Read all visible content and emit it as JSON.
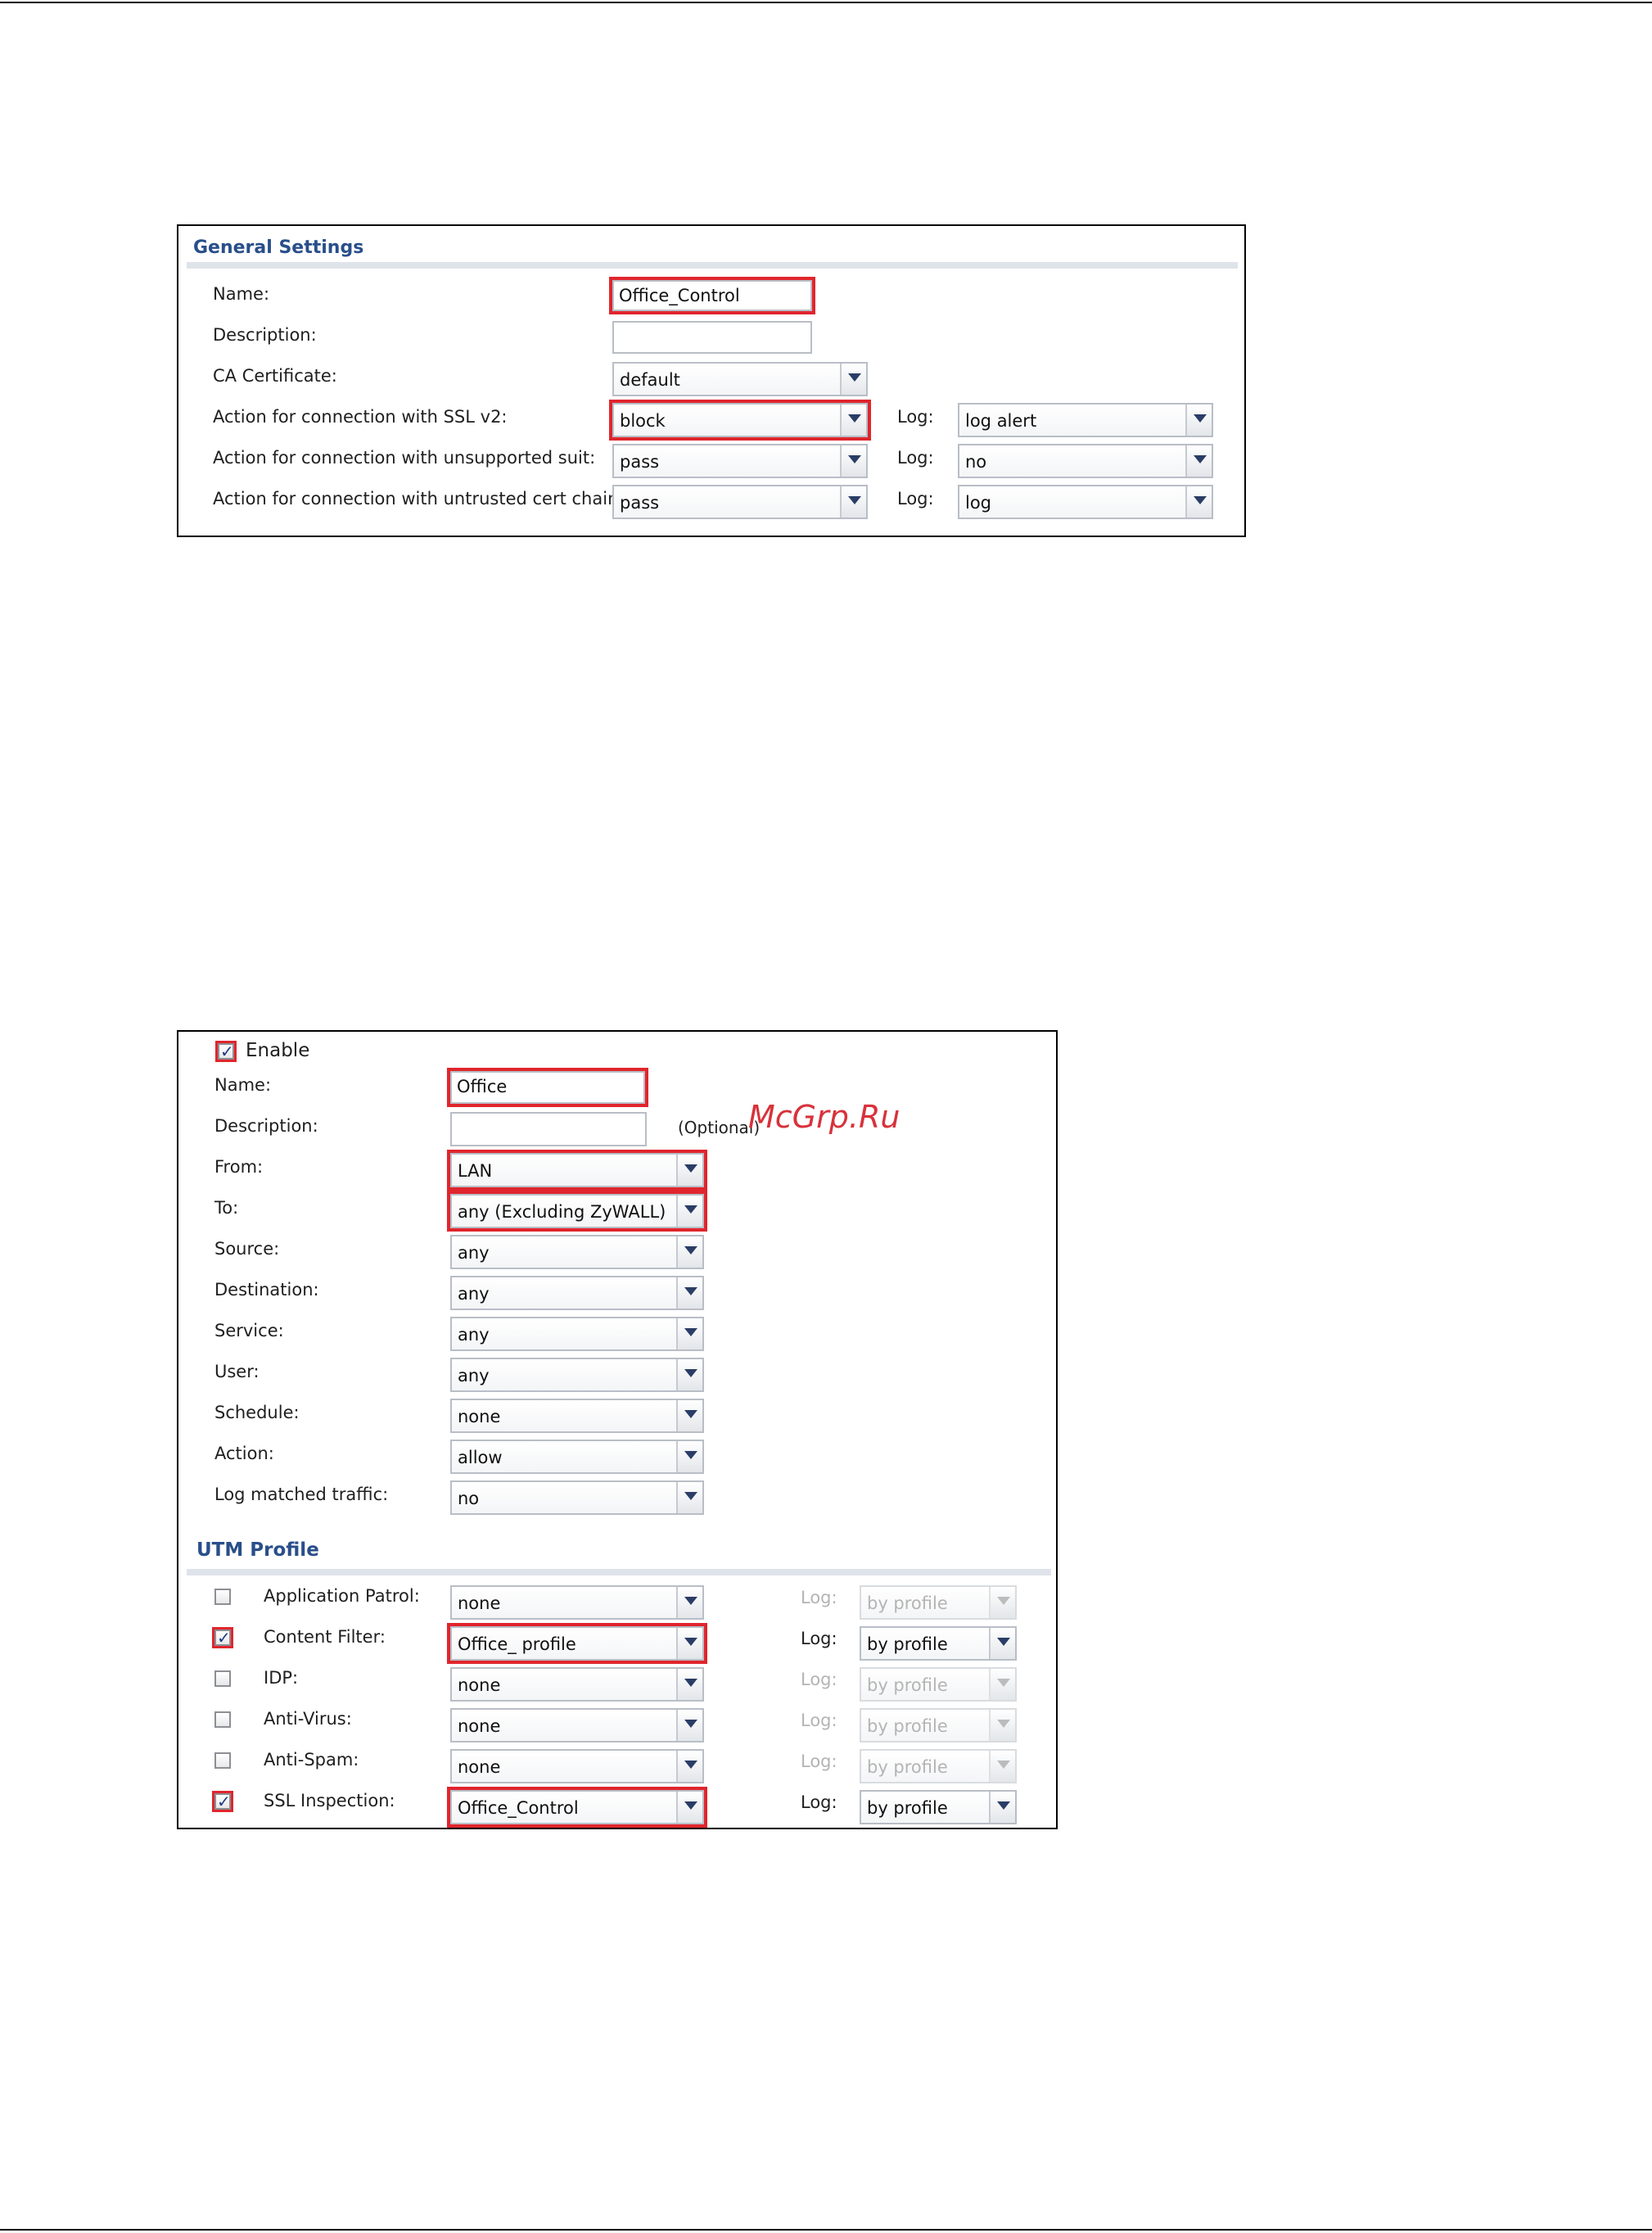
{
  "general": {
    "title": "General Settings",
    "rows": [
      {
        "label": "Name:",
        "value": "Office_Control"
      },
      {
        "label": "Description:",
        "value": ""
      },
      {
        "label": "CA Certificate:",
        "value": "default"
      },
      {
        "label": "Action for connection with SSL v2:",
        "value": "block",
        "log_label": "Log:",
        "log_value": "log alert"
      },
      {
        "label": "Action for connection with unsupported suit:",
        "value": "pass",
        "log_label": "Log:",
        "log_value": "no"
      },
      {
        "label": "Action for connection with untrusted cert chain:",
        "value": "pass",
        "log_label": "Log:",
        "log_value": "log"
      }
    ]
  },
  "policy": {
    "enable_label": "Enable",
    "optional_label": "(Optional)",
    "watermark": "McGrp.Ru",
    "rows": [
      {
        "label": "Name:",
        "value": "Office"
      },
      {
        "label": "Description:",
        "value": ""
      },
      {
        "label": "From:",
        "value": "LAN"
      },
      {
        "label": "To:",
        "value": "any (Excluding ZyWALL)"
      },
      {
        "label": "Source:",
        "value": "any"
      },
      {
        "label": "Destination:",
        "value": "any"
      },
      {
        "label": "Service:",
        "value": "any"
      },
      {
        "label": "User:",
        "value": "any"
      },
      {
        "label": "Schedule:",
        "value": "none"
      },
      {
        "label": "Action:",
        "value": "allow"
      },
      {
        "label": "Log matched traffic:",
        "value": "no"
      }
    ]
  },
  "utm": {
    "title": "UTM Profile",
    "rows": [
      {
        "label": "Application Patrol:",
        "value": "none",
        "log_label": "Log:",
        "log_value": "by profile",
        "checked": false
      },
      {
        "label": "Content Filter:",
        "value": "Office_ profile",
        "log_label": "Log:",
        "log_value": "by profile",
        "checked": true
      },
      {
        "label": "IDP:",
        "value": "none",
        "log_label": "Log:",
        "log_value": "by profile",
        "checked": false
      },
      {
        "label": "Anti-Virus:",
        "value": "none",
        "log_label": "Log:",
        "log_value": "by profile",
        "checked": false
      },
      {
        "label": "Anti-Spam:",
        "value": "none",
        "log_label": "Log:",
        "log_value": "by profile",
        "checked": false
      },
      {
        "label": "SSL Inspection:",
        "value": "Office_Control",
        "log_label": "Log:",
        "log_value": "by profile",
        "checked": true
      }
    ]
  },
  "colors": {
    "highlight": "#e0252d",
    "section_title": "#294f8a"
  }
}
